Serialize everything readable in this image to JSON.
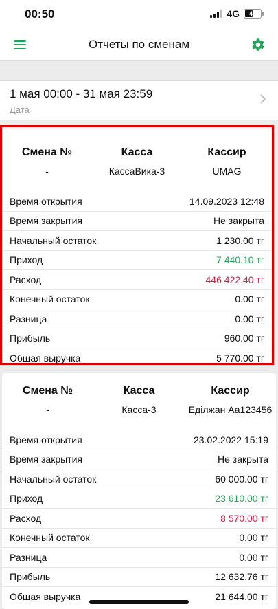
{
  "status": {
    "time": "00:50",
    "network": "4G",
    "battery": "47"
  },
  "appbar": {
    "title": "Отчеты по сменам"
  },
  "date_filter": {
    "value": "1 мая 00:00 - 31 мая 23:59",
    "label": "Дата"
  },
  "cards": [
    {
      "headers": {
        "shift": "Смена №",
        "register": "Касса",
        "cashier": "Кассир"
      },
      "shift_no": "-",
      "register": "КассаВика-3",
      "cashier": "UMAG",
      "rows": [
        {
          "label": "Время открытия",
          "value": "14.09.2023 12:48",
          "tone": ""
        },
        {
          "label": "Время закрытия",
          "value": "Не закрыта",
          "tone": ""
        },
        {
          "label": "Начальный остаток",
          "value": "1 230.00 тг",
          "tone": ""
        },
        {
          "label": "Приход",
          "value": "7 440.10 тг",
          "tone": "green"
        },
        {
          "label": "Расход",
          "value": "446 422.40 тг",
          "tone": "red"
        },
        {
          "label": "Конечный остаток",
          "value": "0.00 тг",
          "tone": ""
        },
        {
          "label": "Разница",
          "value": "0.00 тг",
          "tone": ""
        },
        {
          "label": "Прибыль",
          "value": "960.00 тг",
          "tone": ""
        },
        {
          "label": "Общая выручка",
          "value": "5 770.00 тг",
          "tone": ""
        }
      ]
    },
    {
      "headers": {
        "shift": "Смена №",
        "register": "Касса",
        "cashier": "Кассир"
      },
      "shift_no": "-",
      "register": "Касса-3",
      "cashier": "Еділжан Аа123456",
      "rows": [
        {
          "label": "Время открытия",
          "value": "23.02.2022 15:19",
          "tone": ""
        },
        {
          "label": "Время закрытия",
          "value": "Не закрыта",
          "tone": ""
        },
        {
          "label": "Начальный остаток",
          "value": "60 000.00 тг",
          "tone": ""
        },
        {
          "label": "Приход",
          "value": "23 610.00 тг",
          "tone": "green"
        },
        {
          "label": "Расход",
          "value": "8 570.00 тг",
          "tone": "red"
        },
        {
          "label": "Конечный остаток",
          "value": "0.00 тг",
          "tone": ""
        },
        {
          "label": "Разница",
          "value": "0.00 тг",
          "tone": ""
        },
        {
          "label": "Прибыль",
          "value": "12 632.76 тг",
          "tone": ""
        },
        {
          "label": "Общая выручка",
          "value": "21 644.00 тг",
          "tone": ""
        }
      ]
    }
  ],
  "colors": {
    "accent": "#25a35a",
    "expense": "#d81b47",
    "highlight_border": "#e00000"
  }
}
